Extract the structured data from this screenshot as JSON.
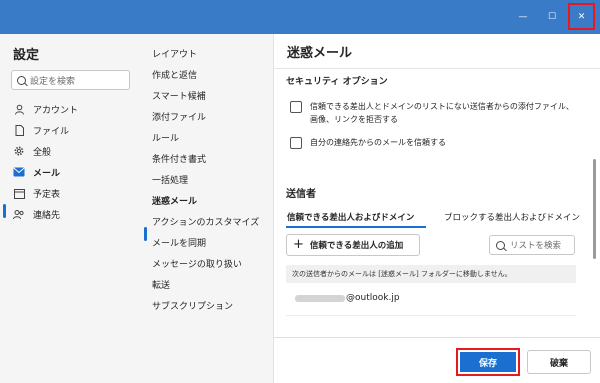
{
  "window": {
    "minimize_glyph": "—",
    "maximize_glyph": "☐",
    "close_glyph": "✕",
    "accent_color": "#3a7bc8",
    "highlight_color": "#e8181f"
  },
  "settings": {
    "title": "設定",
    "search_placeholder": "設定を検索",
    "categories": [
      {
        "label": "アカウント",
        "icon": "person-icon"
      },
      {
        "label": "ファイル",
        "icon": "document-icon"
      },
      {
        "label": "全般",
        "icon": "gear-icon"
      },
      {
        "label": "メール",
        "icon": "mail-icon",
        "active": true
      },
      {
        "label": "予定表",
        "icon": "calendar-icon"
      },
      {
        "label": "連絡先",
        "icon": "people-icon"
      }
    ]
  },
  "mail_menu": {
    "items": [
      "レイアウト",
      "作成と返信",
      "スマート候補",
      "添付ファイル",
      "ルール",
      "条件付き書式",
      "一括処理",
      "迷惑メール",
      "アクションのカスタマイズ",
      "メールを同期",
      "メッセージの取り扱い",
      "転送",
      "サブスクリプション"
    ],
    "active": "迷惑メール"
  },
  "junk": {
    "title": "迷惑メール",
    "security_title": "セキュリティ オプション",
    "options": [
      {
        "label": "信頼できる差出人とドメインのリストにない送信者からの添付ファイル、画像、リンクを拒否する",
        "checked": false
      },
      {
        "label": "自分の連絡先からのメールを信頼する",
        "checked": false
      }
    ],
    "senders_title": "送信者",
    "tabs": [
      "信頼できる差出人およびドメイン",
      "ブロックする差出人およびドメイン"
    ],
    "add_button": "信頼できる差出人の追加",
    "list_search_placeholder": "リストを検索",
    "info_text": "次の送信者からのメールは [迷惑メール] フォルダーに移動しません。",
    "entry_domain": "@outlook.jp"
  },
  "footer": {
    "save": "保存",
    "discard": "破棄"
  }
}
